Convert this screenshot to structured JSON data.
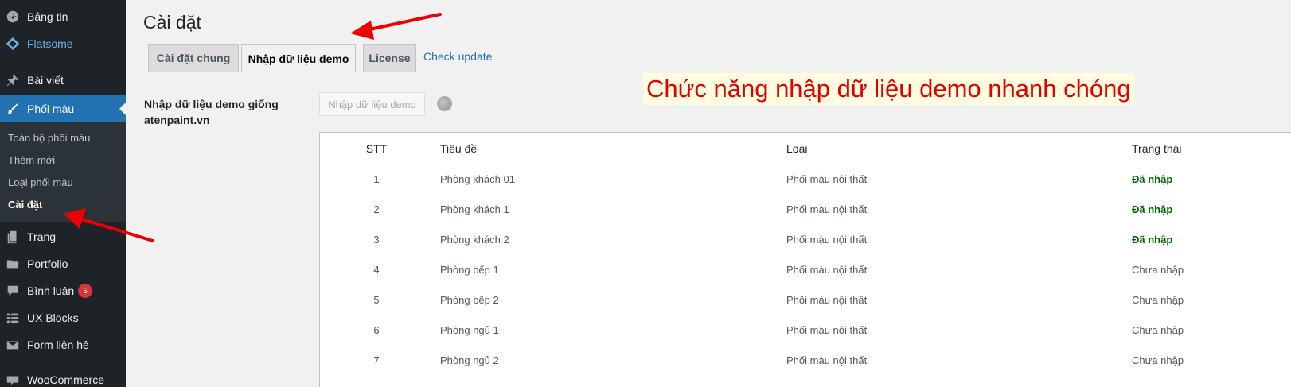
{
  "sidebar": {
    "items": [
      {
        "label": "Bảng tin",
        "icon": "dashboard-icon"
      },
      {
        "label": "Flatsome",
        "icon": "flatsome-icon"
      },
      {
        "label": "Bài viết",
        "icon": "pin-icon"
      },
      {
        "label": "Phối màu",
        "icon": "brush-icon"
      },
      {
        "label": "Trang",
        "icon": "page-icon"
      },
      {
        "label": "Portfolio",
        "icon": "folder-icon"
      },
      {
        "label": "Bình luận",
        "icon": "comment-icon",
        "badge": "5"
      },
      {
        "label": "UX Blocks",
        "icon": "blocks-icon"
      },
      {
        "label": "Form liên hệ",
        "icon": "mail-icon"
      },
      {
        "label": "WooCommerce",
        "icon": "woo-icon"
      }
    ],
    "submenu": [
      "Toàn bộ phối màu",
      "Thêm mới",
      "Loại phối màu",
      "Cài đặt"
    ]
  },
  "page": {
    "title": "Cài đặt",
    "tabs": [
      "Cài đặt chung",
      "Nhập dữ liệu demo",
      "License"
    ],
    "link": "Check update",
    "annotation": "Chức năng nhập dữ liệu demo nhanh chóng",
    "field_label": "Nhập dữ liệu demo giống atenpaint.vn",
    "import_button": "Nhập dữ liệu demo"
  },
  "table": {
    "headers": [
      "STT",
      "Tiêu đề",
      "Loại",
      "Trạng thái"
    ],
    "rows": [
      {
        "stt": "1",
        "title": "Phòng khách 01",
        "type": "Phối màu nội thất",
        "status": "Đã nhập"
      },
      {
        "stt": "2",
        "title": "Phòng khách 1",
        "type": "Phối màu nội thất",
        "status": "Đã nhập"
      },
      {
        "stt": "3",
        "title": "Phòng khách 2",
        "type": "Phối màu nội thất",
        "status": "Đã nhập"
      },
      {
        "stt": "4",
        "title": "Phòng bếp 1",
        "type": "Phối màu nội thất",
        "status": "Chưa nhập"
      },
      {
        "stt": "5",
        "title": "Phòng bếp 2",
        "type": "Phối màu nội thất",
        "status": "Chưa nhập"
      },
      {
        "stt": "6",
        "title": "Phòng ngủ 1",
        "type": "Phối màu nội thất",
        "status": "Chưa nhập"
      },
      {
        "stt": "7",
        "title": "Phòng ngủ 2",
        "type": "Phối màu nội thất",
        "status": "Chưa nhập"
      }
    ]
  },
  "colors": {
    "sidebar_bg": "#1d2327",
    "active": "#2271b1",
    "imported": "#006400",
    "annotation": "#e00000",
    "arrow": "#ee0000"
  }
}
